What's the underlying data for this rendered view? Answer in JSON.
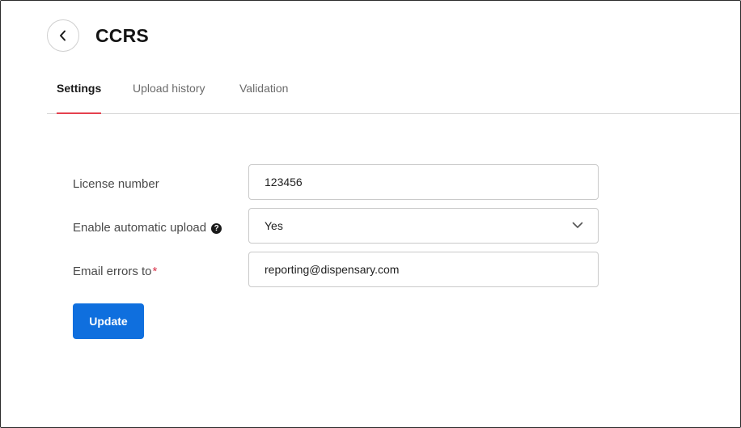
{
  "header": {
    "back_icon": "chevron-left-icon",
    "title": "CCRS"
  },
  "tabs": [
    {
      "label": "Settings",
      "active": true
    },
    {
      "label": "Upload history",
      "active": false
    },
    {
      "label": "Validation",
      "active": false
    }
  ],
  "form": {
    "license_number": {
      "label": "License number",
      "value": "123456"
    },
    "automatic_upload": {
      "label": "Enable automatic upload",
      "help_icon": "question-circle-icon",
      "help_glyph": "?",
      "value": "Yes",
      "dropdown_icon": "chevron-down-icon"
    },
    "email_errors": {
      "label": "Email errors to",
      "required_marker": "*",
      "value": "reporting@dispensary.com"
    },
    "submit_label": "Update"
  },
  "colors": {
    "accent_tab_underline": "#e5414f",
    "primary_button": "#0f6fde",
    "required": "#d9334a"
  }
}
